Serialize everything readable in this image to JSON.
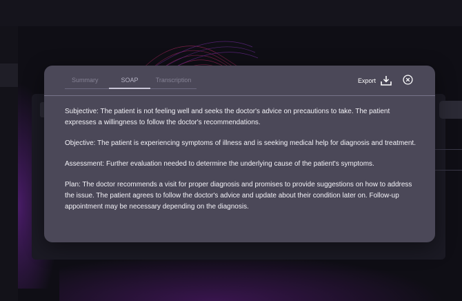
{
  "modal": {
    "tabs": [
      {
        "label": "Summary",
        "active": false
      },
      {
        "label": "SOAP",
        "active": true
      },
      {
        "label": "Transcription",
        "active": false
      }
    ],
    "export_label": "Export",
    "export_icon": "download-icon",
    "close_icon": "close-circle-icon",
    "soap": {
      "subjective": "Subjective: The patient is not feeling well and seeks the doctor's advice on precautions to take. The patient expresses a willingness to follow the doctor's recommendations.",
      "objective": "Objective: The patient is experiencing symptoms of illness and is seeking medical help for diagnosis and treatment.",
      "assessment": "Assessment: Further evaluation needed to determine the underlying cause of the patient's symptoms.",
      "plan": "Plan: The doctor recommends a visit for proper diagnosis and promises to provide suggestions on how to address the issue. The patient agrees to follow the doctor's advice and update about their condition later on. Follow-up appointment may be necessary depending on the diagnosis."
    }
  },
  "colors": {
    "modal_bg": "#4b4858",
    "backdrop": "#0c0b12",
    "accent_glow": "#c0306a",
    "text": "#f4f3f8"
  }
}
